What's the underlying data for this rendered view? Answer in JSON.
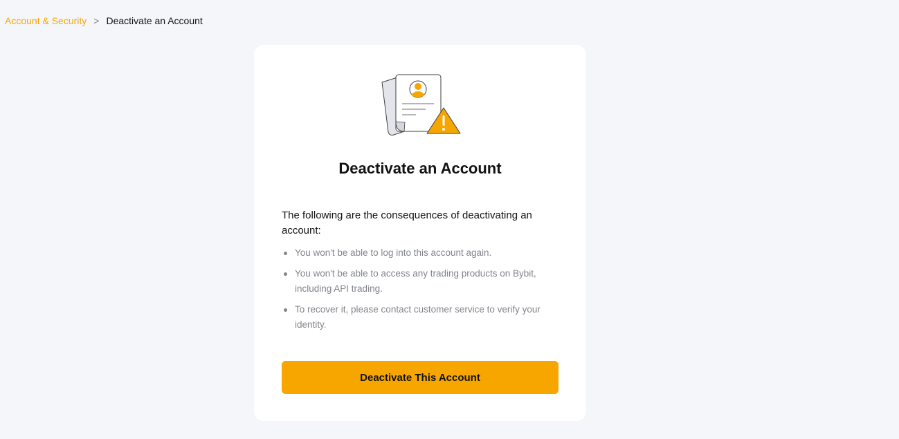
{
  "breadcrumb": {
    "parent": "Account & Security",
    "separator": ">",
    "current": "Deactivate an Account"
  },
  "card": {
    "illustration": "document-warning-illustration",
    "title": "Deactivate an Account",
    "intro": "The following are the consequences of deactivating an account:",
    "consequences": [
      "You won't be able to log into this account again.",
      "You won't be able to access any trading products on Bybit, including API trading.",
      "To recover it, please contact customer service to verify your identity."
    ],
    "button_label": "Deactivate This Account"
  },
  "colors": {
    "accent": "#f7a600",
    "background": "#f5f6f9",
    "card": "#ffffff",
    "text_primary": "#121214",
    "text_secondary": "#81858c"
  }
}
